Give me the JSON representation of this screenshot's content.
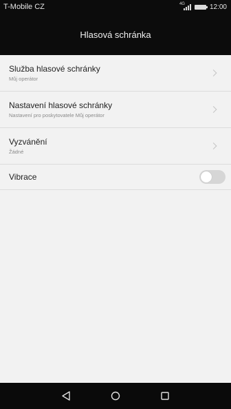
{
  "status_bar": {
    "carrier": "T-Mobile CZ",
    "network_tag": "4G",
    "time": "12:00"
  },
  "header": {
    "title": "Hlasová schránka"
  },
  "settings": [
    {
      "title": "Služba hlasové schránky",
      "subtitle": "Můj operátor",
      "control": "chevron-icon"
    },
    {
      "title": "Nastavení hlasové schránky",
      "subtitle": "Nastavení pro poskytovatele Můj operátor",
      "control": "chevron-icon"
    },
    {
      "title": "Vyzvánění",
      "subtitle": "Žádné",
      "control": "chevron-icon"
    },
    {
      "title": "Vibrace",
      "control": "toggle",
      "enabled": false
    }
  ],
  "navigation": {
    "buttons": [
      "back-icon",
      "home-icon",
      "recents-icon"
    ]
  },
  "colors": {
    "status_bar_bg": "#0c0c0c",
    "background": "#f2f2f2",
    "divider": "#dcdcdc",
    "toggle_off": "#d6d6d6"
  }
}
